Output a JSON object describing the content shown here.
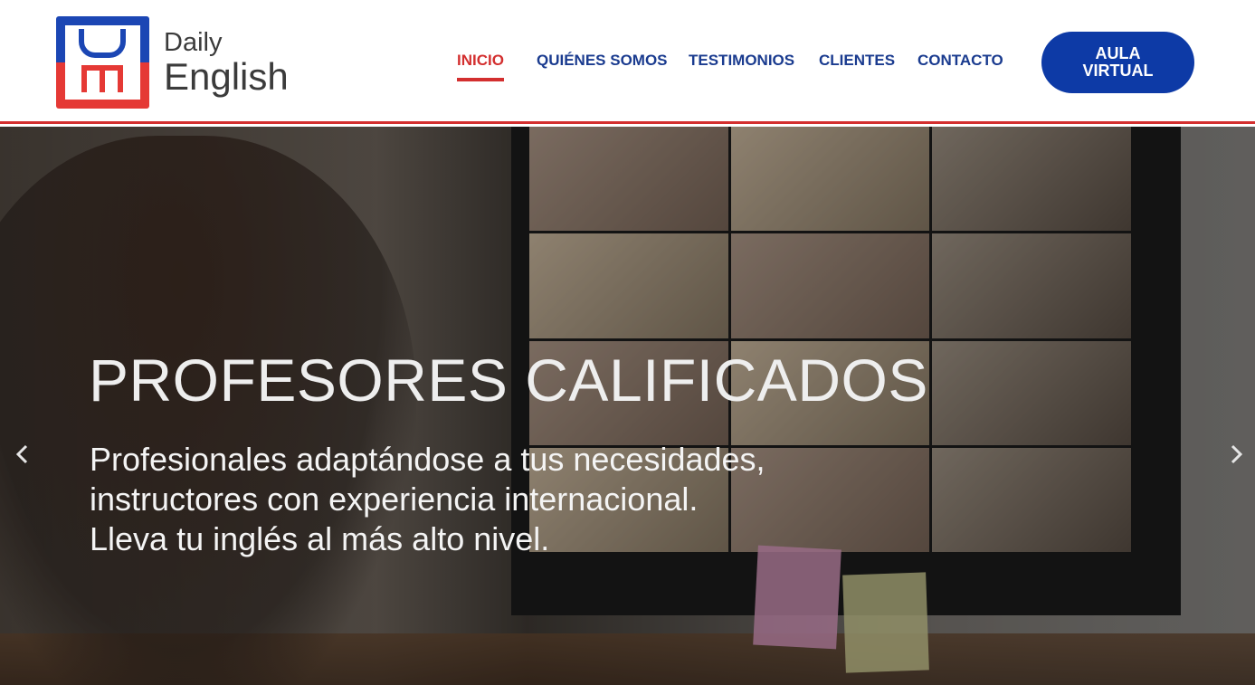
{
  "logo": {
    "line1": "Daily",
    "line2": "English"
  },
  "nav": [
    {
      "label": "INICIO",
      "active": true
    },
    {
      "label": "QUIÉNES SOMOS",
      "active": false
    },
    {
      "label": "TESTIMONIOS",
      "active": false
    },
    {
      "label": "CLIENTES",
      "active": false
    },
    {
      "label": "CONTACTO",
      "active": false
    }
  ],
  "cta": {
    "line1": "AULA",
    "line2": "VIRTUAL"
  },
  "hero": {
    "title": "PROFESORES CALIFICADOS",
    "lines": [
      "Profesionales adaptándose a tus necesidades,",
      "instructores con experiencia internacional.",
      "Lleva tu inglés al más alto nivel."
    ],
    "prev_icon": "chevron-left-icon",
    "next_icon": "chevron-right-icon"
  },
  "colors": {
    "brand_blue": "#0d3aa6",
    "accent_red": "#d32f2f",
    "nav_text": "#1a3b8f"
  }
}
